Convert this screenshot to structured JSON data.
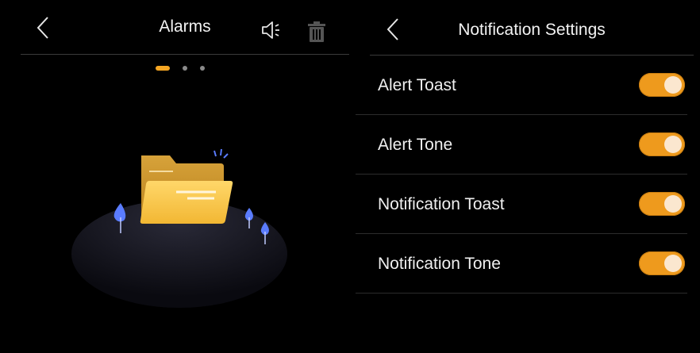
{
  "alarms_panel": {
    "title": "Alarms",
    "icons": [
      "back-chevron-icon",
      "speaker-icon",
      "trash-icon"
    ],
    "page_indicator": {
      "count": 3,
      "active_index": 0
    },
    "empty_state_illustration": "folder-icon"
  },
  "notification_panel": {
    "title": "Notification Settings",
    "items": [
      {
        "label": "Alert Toast",
        "enabled": true
      },
      {
        "label": "Alert Tone",
        "enabled": true
      },
      {
        "label": "Notification Toast",
        "enabled": true
      },
      {
        "label": "Notification Tone",
        "enabled": true
      }
    ]
  },
  "colors": {
    "accent": "#f5a623",
    "toggle_on": "#ee9a1d",
    "background": "#000000"
  }
}
